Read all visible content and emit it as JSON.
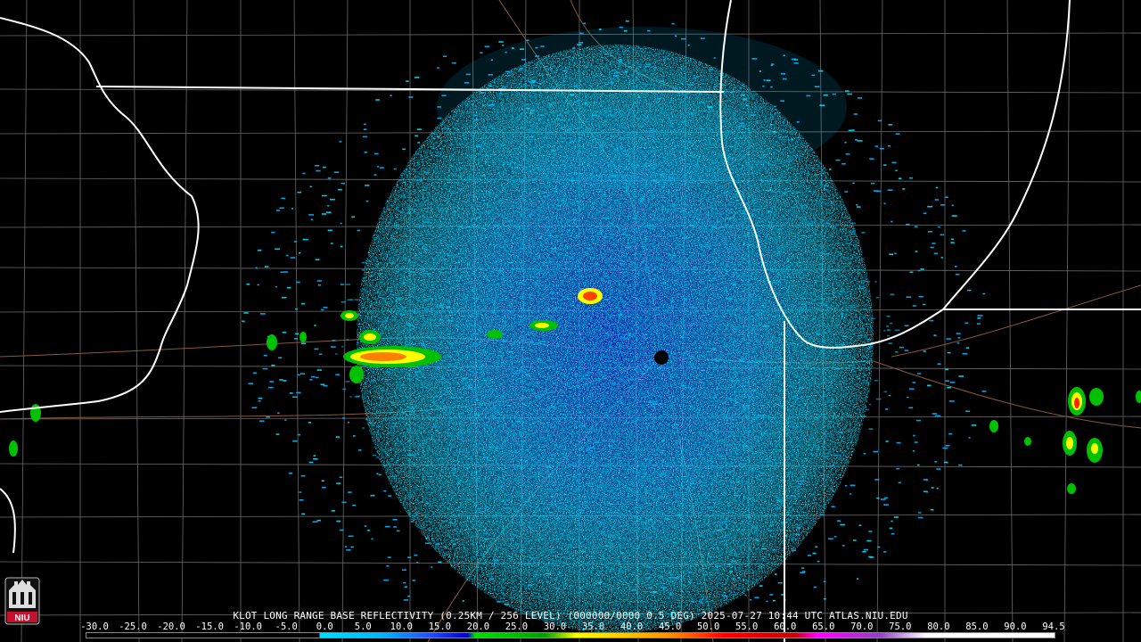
{
  "product": {
    "caption": "KLOT LONG RANGE BASE REFLECTIVITY (0.25KM / 256 LEVEL) (000000/0000 0.5 DEG) 2025-07-27 10:44 UTC  ATLAS.NIU.EDU"
  },
  "logo": {
    "text": "NIU",
    "icon": "university-building-icon"
  },
  "colorbar": {
    "labels": [
      "-30.0",
      "-25.0",
      "-20.0",
      "-15.0",
      "-10.0",
      "-5.0",
      "0.0",
      "5.0",
      "10.0",
      "15.0",
      "20.0",
      "25.0",
      "30.0",
      "35.0",
      "40.0",
      "45.0",
      "50.0",
      "55.0",
      "60.0",
      "65.0",
      "70.0",
      "75.0",
      "80.0",
      "85.0",
      "90.0",
      "94.5"
    ],
    "values": [
      -30,
      -25,
      -20,
      -15,
      -10,
      -5,
      0,
      5,
      10,
      15,
      20,
      25,
      30,
      35,
      40,
      45,
      50,
      55,
      60,
      65,
      70,
      75,
      80,
      85,
      90,
      94.5
    ],
    "colors": {
      "below_zero": "#000000",
      "light_cyan": "#00e0ff",
      "cyan": "#00b4ff",
      "blue": "#2450ff",
      "dark_blue": "#0000c8",
      "green": "#00e000",
      "dark_green": "#00a000",
      "yellow": "#ffff00",
      "orange": "#ff9000",
      "red": "#ff0000",
      "dark_red": "#c00000",
      "magenta": "#ff00ff",
      "purple": "#9040c0",
      "white": "#ffffff"
    }
  },
  "map_colors": {
    "background": "#000000",
    "state_border": "#ffffff",
    "county_border": "#6a6a6a",
    "road": "#8a5a3a"
  }
}
